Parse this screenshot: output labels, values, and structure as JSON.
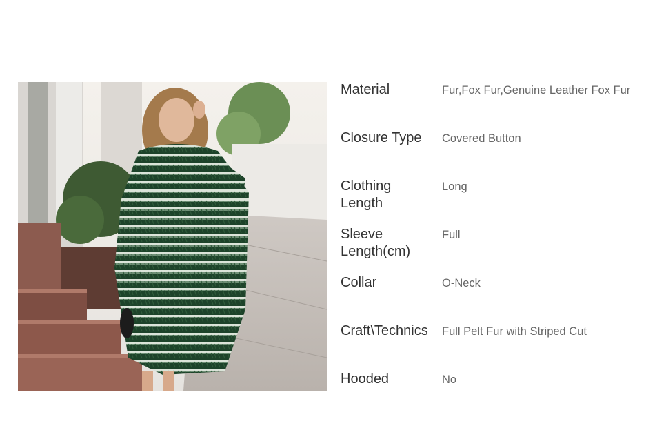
{
  "product": {
    "image": {
      "subject": "model wearing long green and white striped fox fur coat on a city street"
    },
    "specs": [
      {
        "label": "Material",
        "value": "Fur,Fox Fur,Genuine Leather Fox Fur"
      },
      {
        "label": "Closure Type",
        "value": "Covered Button"
      },
      {
        "label": "Clothing Length",
        "value": "Long"
      },
      {
        "label": "Sleeve Length(cm)",
        "value": "Full"
      },
      {
        "label": "Collar",
        "value": "O-Neck"
      },
      {
        "label": "Craft\\Technics",
        "value": "Full Pelt Fur with Striped Cut"
      },
      {
        "label": "Hooded",
        "value": "No"
      }
    ]
  },
  "colors": {
    "label": "#333333",
    "value": "#666666",
    "coat_green": "#1f4a2c",
    "coat_stripe": "#dfe8de"
  }
}
